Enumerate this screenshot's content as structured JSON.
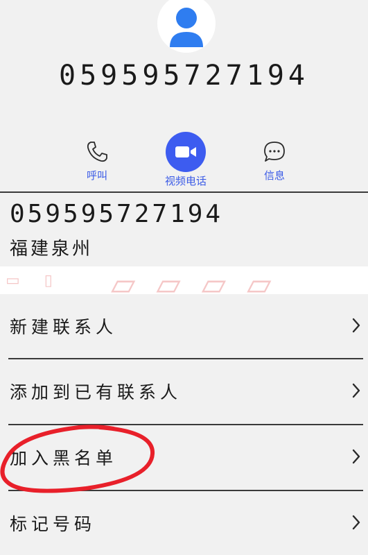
{
  "contact": {
    "number": "059595727194",
    "location": "福建泉州"
  },
  "actions": {
    "call_label": "呼叫",
    "video_label": "视频电话",
    "message_label": "信息"
  },
  "menu": {
    "items": [
      {
        "label": "新建联系人"
      },
      {
        "label": "添加到已有联系人"
      },
      {
        "label": "加入黑名单"
      },
      {
        "label": "标记号码"
      }
    ]
  },
  "colors": {
    "accent": "#3d5cf0",
    "avatar": "#2f7df0",
    "annotation": "#e8202a"
  }
}
